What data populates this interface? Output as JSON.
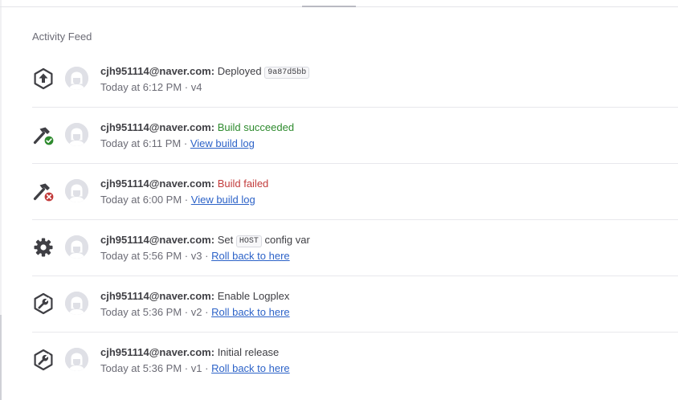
{
  "feed": {
    "title": "Activity Feed",
    "colors": {
      "success": "#2e8b2e",
      "failure": "#c23b3b",
      "link": "#2d63c8"
    },
    "entries": [
      {
        "icon": "deploy-icon",
        "user": "cjh951114@naver.com:",
        "action": "Deployed",
        "code": "9a87d5bb",
        "time": "Today at 6:12 PM",
        "sep": "·",
        "release": "v4"
      },
      {
        "icon": "build-succeeded-icon",
        "user": "cjh951114@naver.com:",
        "action": "Build succeeded",
        "time": "Today at 6:11 PM",
        "sep": "·",
        "link": "View build log"
      },
      {
        "icon": "build-failed-icon",
        "user": "cjh951114@naver.com:",
        "action": "Build failed",
        "time": "Today at 6:00 PM",
        "sep": "·",
        "link": "View build log"
      },
      {
        "icon": "gear-icon",
        "user": "cjh951114@naver.com:",
        "action_pre": "Set",
        "code": "HOST",
        "action_post": "config var",
        "time": "Today at 5:56 PM",
        "sep": "·",
        "release": "v3",
        "sep2": "·",
        "link": "Roll back to here"
      },
      {
        "icon": "addon-wrench-icon",
        "user": "cjh951114@naver.com:",
        "action": "Enable Logplex",
        "time": "Today at 5:36 PM",
        "sep": "·",
        "release": "v2",
        "sep2": "·",
        "link": "Roll back to here"
      },
      {
        "icon": "addon-wrench-icon",
        "user": "cjh951114@naver.com:",
        "action": "Initial release",
        "time": "Today at 5:36 PM",
        "sep": "·",
        "release": "v1",
        "sep2": "·",
        "link": "Roll back to here"
      }
    ]
  }
}
